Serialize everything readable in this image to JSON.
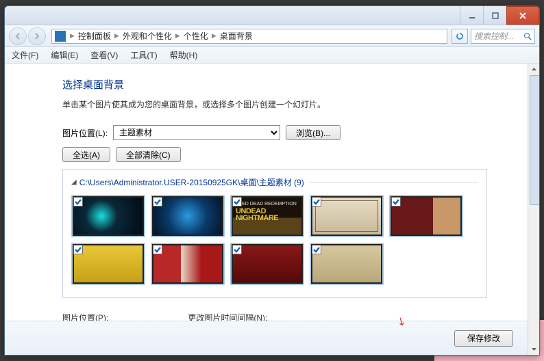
{
  "breadcrumb": [
    "控制面板",
    "外观和个性化",
    "个性化",
    "桌面背景"
  ],
  "search_placeholder": "搜索控制...",
  "menu": {
    "file": "文件(F)",
    "edit": "编辑(E)",
    "view": "查看(V)",
    "tools": "工具(T)",
    "help": "帮助(H)"
  },
  "heading": "选择桌面背景",
  "description": "单击某个图片使其成为您的桌面背景，或选择多个图片创建一个幻灯片。",
  "pic_location_label": "图片位置(L):",
  "pic_location_value": "主题素材",
  "browse_btn": "浏览(B)...",
  "select_all_btn": "全选(A)",
  "clear_all_btn": "全部清除(C)",
  "folder_path": "C:\\Users\\Administrator.USER-20150925GK\\桌面\\主题素材 (9)",
  "thumbs": [
    {
      "checked": true,
      "class": "t1"
    },
    {
      "checked": true,
      "class": "t2"
    },
    {
      "checked": true,
      "class": "t3",
      "line1": "RED DEAD REDEMPTION",
      "line2": "UNDEAD",
      "line3": "NIGHTMARE"
    },
    {
      "checked": true,
      "class": "t4"
    },
    {
      "checked": true,
      "class": "t5"
    },
    {
      "checked": true,
      "class": "t6"
    },
    {
      "checked": true,
      "class": "t7"
    },
    {
      "checked": true,
      "class": "t8"
    },
    {
      "checked": true,
      "class": "t9"
    }
  ],
  "position_label": "图片位置(P):",
  "interval_label": "更改图片时间间隔(N):",
  "save_btn": "保存修改"
}
